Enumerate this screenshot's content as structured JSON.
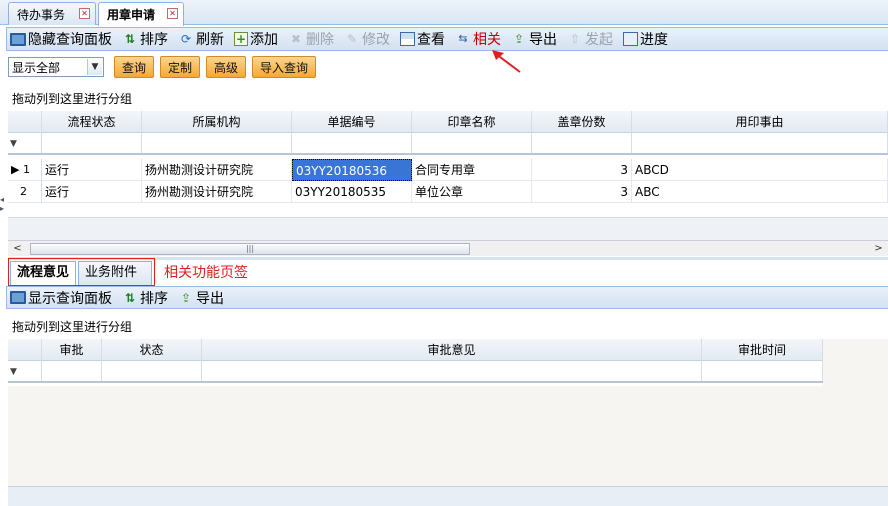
{
  "tabs": [
    {
      "label": "待办事务",
      "active": false
    },
    {
      "label": "用章申请",
      "active": true
    }
  ],
  "toolbar": {
    "hide_panel": "隐藏查询面板",
    "sort": "排序",
    "refresh": "刷新",
    "add": "添加",
    "delete": "删除",
    "edit": "修改",
    "view": "查看",
    "related": "相关",
    "export": "导出",
    "start": "发起",
    "progress": "进度"
  },
  "filter": {
    "select_value": "显示全部",
    "query": "查询",
    "customize": "定制",
    "advanced": "高级",
    "import_query": "导入查询"
  },
  "grid1": {
    "group_hint": "拖动列到这里进行分组",
    "columns": [
      "流程状态",
      "所属机构",
      "单据编号",
      "印章名称",
      "盖章份数",
      "用印事由"
    ],
    "rows": [
      {
        "idx": "1",
        "status": "运行",
        "org": "扬州勘测设计研究院",
        "code": "03YY20180536",
        "seal": "合同专用章",
        "copies": "3",
        "reason": "ABCD"
      },
      {
        "idx": "2",
        "status": "运行",
        "org": "扬州勘测设计研究院",
        "code": "03YY20180535",
        "seal": "单位公章",
        "copies": "3",
        "reason": "ABC"
      }
    ]
  },
  "bottom_tabs": [
    {
      "label": "流程意见",
      "active": true
    },
    {
      "label": "业务附件",
      "active": false
    }
  ],
  "annotation": "相关功能页签",
  "toolbar2": {
    "show_panel": "显示查询面板",
    "sort": "排序",
    "export": "导出"
  },
  "grid2": {
    "group_hint": "拖动列到这里进行分组",
    "columns": [
      "审批",
      "状态",
      "审批意见",
      "审批时间"
    ]
  }
}
